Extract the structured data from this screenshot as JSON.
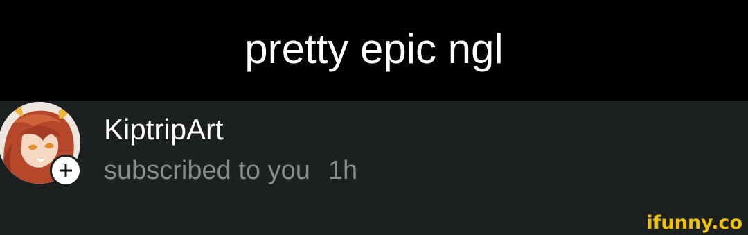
{
  "caption": {
    "text": "pretty epic ngl"
  },
  "notification": {
    "username": "KiptripArt",
    "action": "subscribed to you",
    "time": "1h",
    "avatar_icon": "avatar-anime-character",
    "badge_icon": "plus-icon"
  },
  "watermark": {
    "text": "ifunny.co"
  },
  "colors": {
    "caption_background": "#000000",
    "caption_text": "#ffffff",
    "panel_background": "#1d2020",
    "username_text": "#ffffff",
    "meta_text": "#8a8c8d",
    "watermark": "#f2c200"
  }
}
